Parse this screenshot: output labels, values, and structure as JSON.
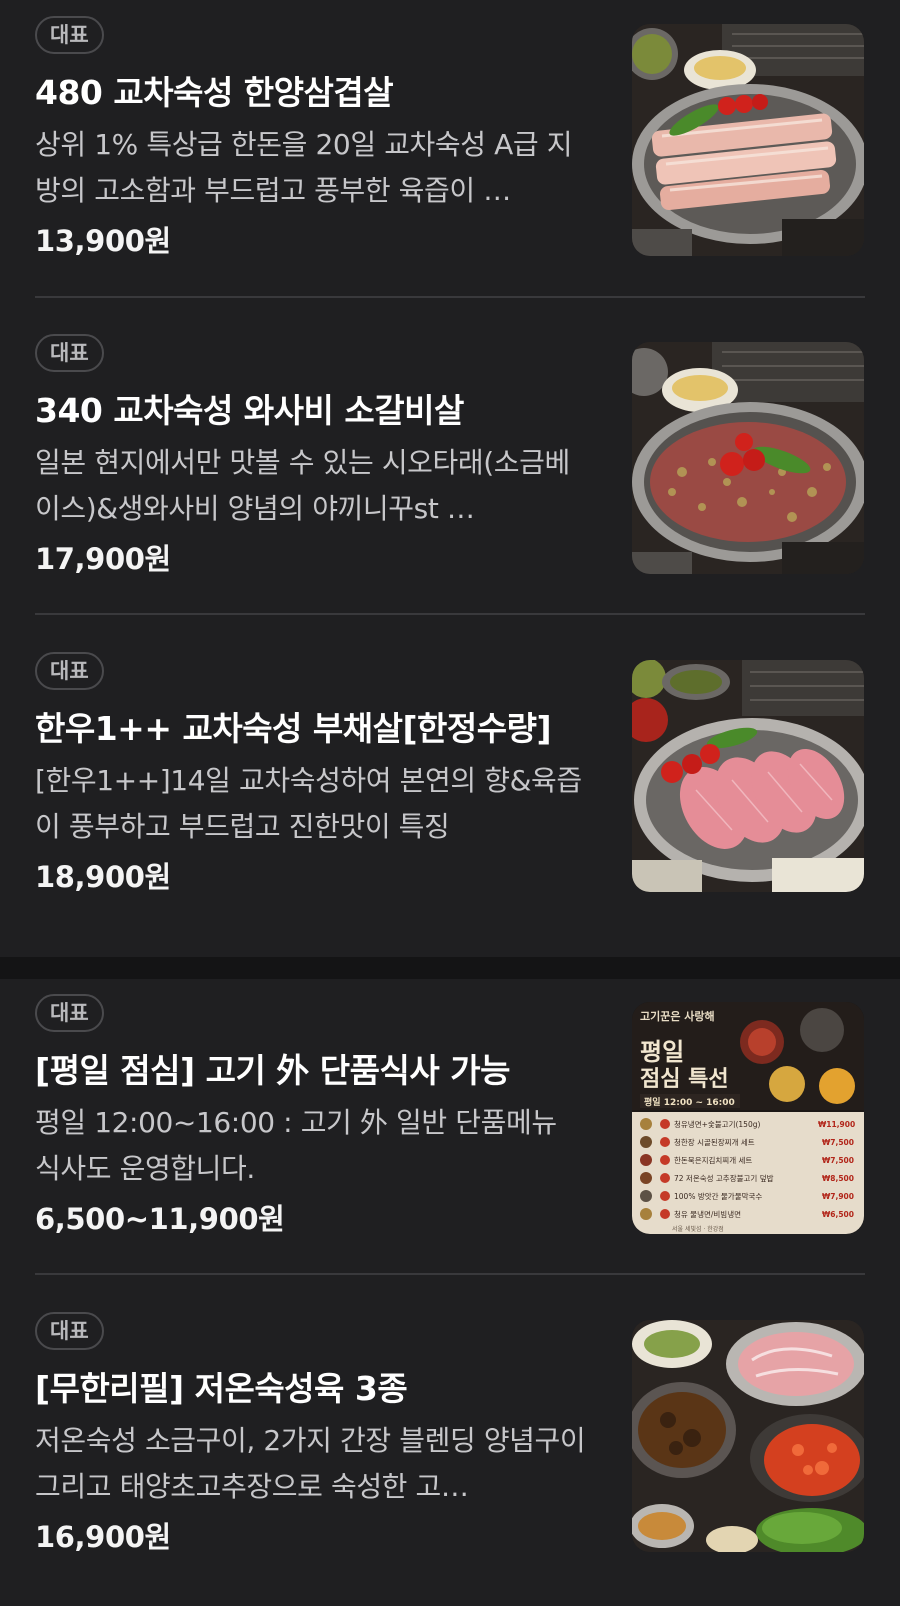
{
  "menu": {
    "items": [
      {
        "badge": "대표",
        "name": "480 교차숙성 한양삼겹살",
        "description": "상위 1% 특상급 한돈을 20일 교차숙성 A급 지방의 고소함과 부드럽고 풍부한 육즙이 …",
        "price": "13,900원",
        "image_icon": "grilled-pork-belly-photo"
      },
      {
        "badge": "대표",
        "name": "340 교차숙성 와사비 소갈비살",
        "description": "일본 현지에서만 맛볼 수 있는 시오타래(소금베이스)&생와사비 양념의 야끼니꾸st …",
        "price": "17,900원",
        "image_icon": "beef-rib-photo"
      },
      {
        "badge": "대표",
        "name": "한우1++ 교차숙성 부채살[한정수량]",
        "description": "[한우1++]14일 교차숙성하여 본연의 향&육즙이 풍부하고 부드럽고 진한맛이 특징",
        "price": "18,900원",
        "image_icon": "hanwoo-top-blade-photo"
      },
      {
        "badge": "대표",
        "name": "[평일 점심] 고기 外 단품식사 가능",
        "description": "평일 12:00~16:00 : 고기 外 일반 단품메뉴 식사도 운영합니다.",
        "price": "6,500~11,900원",
        "image_icon": "lunch-special-menu-poster",
        "poster": {
          "brand": "고기꾼은 사랑해",
          "title_line1": "평일",
          "title_line2": "점심 특선",
          "hours": "평일 12:00 ~ 16:00",
          "rows": [
            {
              "no": "1",
              "label": "청유냉면+숯불고기(150g)",
              "price": "₩11,900"
            },
            {
              "no": "2",
              "label": "청한장 시골된장찌개 세트",
              "price": "₩7,500"
            },
            {
              "no": "3",
              "label": "한돈묵은지김치찌개 세트",
              "price": "₩7,500"
            },
            {
              "no": "4",
              "label": "72 저온숙성 고추장불고기 덮밥",
              "price": "₩8,500"
            },
            {
              "no": "5",
              "label": "100% 방앗간 물가물막국수",
              "price": "₩7,900"
            },
            {
              "no": "6",
              "label": "청유 물냉면/비빔냉면",
              "price": "₩6,500"
            }
          ],
          "footer": "서울 세빛섬 · 한강점"
        }
      },
      {
        "badge": "대표",
        "name": "[무한리필] 저온숙성육 3종",
        "description": "저온숙성 소금구이, 2가지 간장 블렌딩 양념구이 그리고 태양초고추장으로 숙성한 고…",
        "price": "16,900원",
        "image_icon": "unlimited-meat-platter-photo"
      }
    ]
  },
  "colors": {
    "background": "#1f1f21",
    "section_gap": "#141415",
    "divider": "#39393c",
    "badge_border": "#4a4a4d"
  }
}
